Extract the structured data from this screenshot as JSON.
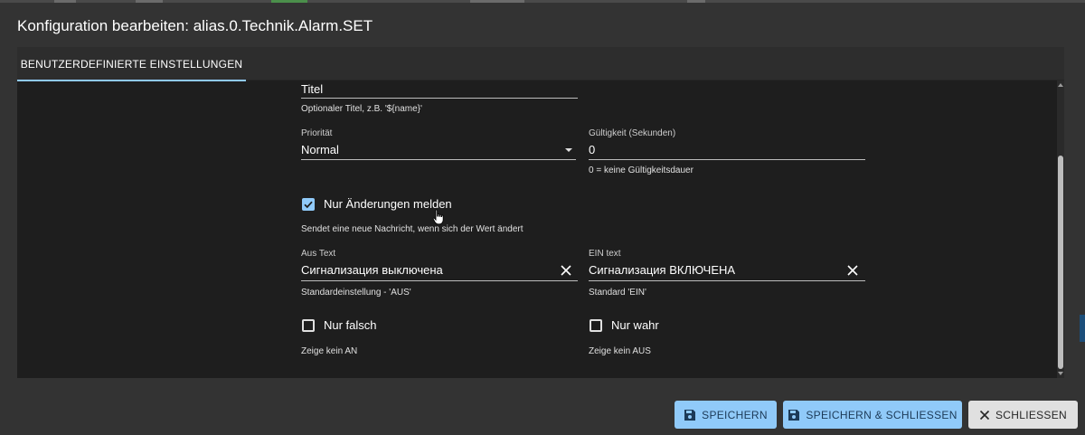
{
  "dialog": {
    "title": "Konfiguration bearbeiten: alias.0.Technik.Alarm.SET"
  },
  "tabs": [
    {
      "label": "BENUTZERDEFINIERTE EINSTELLUNGEN",
      "active": true
    }
  ],
  "form": {
    "titel": {
      "value": "Titel",
      "helper": "Optionaler Titel, z.B. '${name}'"
    },
    "prioritaet": {
      "label": "Priorität",
      "value": "Normal"
    },
    "gueltigkeit": {
      "label": "Gültigkeit (Sekunden)",
      "value": "0",
      "helper": "0 = keine Gültigkeitsdauer"
    },
    "nur_aenderungen": {
      "label": "Nur Änderungen melden",
      "checked": true,
      "helper": "Sendet eine neue Nachricht, wenn sich der Wert ändert"
    },
    "aus_text": {
      "label": "Aus Text",
      "value": "Сигнализация выключена",
      "helper": "Standardeinstellung - 'AUS'"
    },
    "ein_text": {
      "label": "EIN text",
      "value": "Сигнализация ВКЛЮЧЕНА",
      "helper": "Standard 'EIN'"
    },
    "nur_falsch": {
      "label": "Nur falsch",
      "checked": false,
      "helper": "Zeige kein AN"
    },
    "nur_wahr": {
      "label": "Nur wahr",
      "checked": false,
      "helper": "Zeige kein AUS"
    }
  },
  "buttons": {
    "save": "SPEICHERN",
    "save_close": "SPEICHERN & SCHLIESSEN",
    "close": "SCHLIESSEN"
  },
  "colors": {
    "accent": "#90caf9",
    "background": "#333333",
    "panel": "#1e1e1e"
  },
  "icons": {
    "save": "floppy-disk-icon",
    "close": "close-icon",
    "clear": "clear-icon",
    "dropdown": "dropdown-arrow-icon",
    "cursor": "hand-pointer-icon"
  }
}
